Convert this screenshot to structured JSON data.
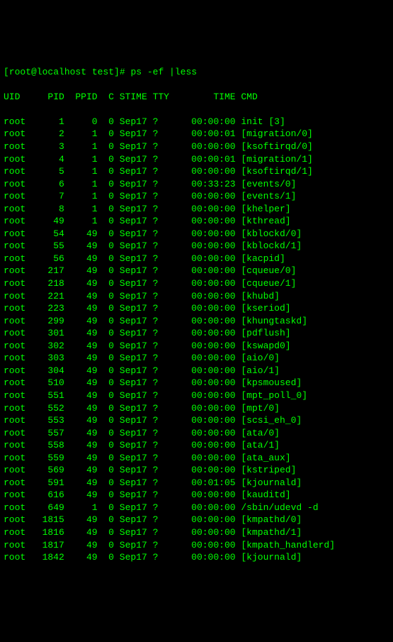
{
  "prompt": {
    "user_host": "[root@localhost test]#",
    "command": "ps -ef |less"
  },
  "headers": {
    "uid": "UID",
    "pid": "PID",
    "ppid": "PPID",
    "c": "C",
    "stime": "STIME",
    "tty": "TTY",
    "time": "TIME",
    "cmd": "CMD"
  },
  "rows": [
    {
      "uid": "root",
      "pid": "1",
      "ppid": "0",
      "c": "0",
      "stime": "Sep17",
      "tty": "?",
      "time": "00:00:00",
      "cmd": "init [3]"
    },
    {
      "uid": "root",
      "pid": "2",
      "ppid": "1",
      "c": "0",
      "stime": "Sep17",
      "tty": "?",
      "time": "00:00:01",
      "cmd": "[migration/0]"
    },
    {
      "uid": "root",
      "pid": "3",
      "ppid": "1",
      "c": "0",
      "stime": "Sep17",
      "tty": "?",
      "time": "00:00:00",
      "cmd": "[ksoftirqd/0]"
    },
    {
      "uid": "root",
      "pid": "4",
      "ppid": "1",
      "c": "0",
      "stime": "Sep17",
      "tty": "?",
      "time": "00:00:01",
      "cmd": "[migration/1]"
    },
    {
      "uid": "root",
      "pid": "5",
      "ppid": "1",
      "c": "0",
      "stime": "Sep17",
      "tty": "?",
      "time": "00:00:00",
      "cmd": "[ksoftirqd/1]"
    },
    {
      "uid": "root",
      "pid": "6",
      "ppid": "1",
      "c": "0",
      "stime": "Sep17",
      "tty": "?",
      "time": "00:33:23",
      "cmd": "[events/0]"
    },
    {
      "uid": "root",
      "pid": "7",
      "ppid": "1",
      "c": "0",
      "stime": "Sep17",
      "tty": "?",
      "time": "00:00:00",
      "cmd": "[events/1]"
    },
    {
      "uid": "root",
      "pid": "8",
      "ppid": "1",
      "c": "0",
      "stime": "Sep17",
      "tty": "?",
      "time": "00:00:00",
      "cmd": "[khelper]"
    },
    {
      "uid": "root",
      "pid": "49",
      "ppid": "1",
      "c": "0",
      "stime": "Sep17",
      "tty": "?",
      "time": "00:00:00",
      "cmd": "[kthread]"
    },
    {
      "uid": "root",
      "pid": "54",
      "ppid": "49",
      "c": "0",
      "stime": "Sep17",
      "tty": "?",
      "time": "00:00:00",
      "cmd": "[kblockd/0]"
    },
    {
      "uid": "root",
      "pid": "55",
      "ppid": "49",
      "c": "0",
      "stime": "Sep17",
      "tty": "?",
      "time": "00:00:00",
      "cmd": "[kblockd/1]"
    },
    {
      "uid": "root",
      "pid": "56",
      "ppid": "49",
      "c": "0",
      "stime": "Sep17",
      "tty": "?",
      "time": "00:00:00",
      "cmd": "[kacpid]"
    },
    {
      "uid": "root",
      "pid": "217",
      "ppid": "49",
      "c": "0",
      "stime": "Sep17",
      "tty": "?",
      "time": "00:00:00",
      "cmd": "[cqueue/0]"
    },
    {
      "uid": "root",
      "pid": "218",
      "ppid": "49",
      "c": "0",
      "stime": "Sep17",
      "tty": "?",
      "time": "00:00:00",
      "cmd": "[cqueue/1]"
    },
    {
      "uid": "root",
      "pid": "221",
      "ppid": "49",
      "c": "0",
      "stime": "Sep17",
      "tty": "?",
      "time": "00:00:00",
      "cmd": "[khubd]"
    },
    {
      "uid": "root",
      "pid": "223",
      "ppid": "49",
      "c": "0",
      "stime": "Sep17",
      "tty": "?",
      "time": "00:00:00",
      "cmd": "[kseriod]"
    },
    {
      "uid": "root",
      "pid": "299",
      "ppid": "49",
      "c": "0",
      "stime": "Sep17",
      "tty": "?",
      "time": "00:00:00",
      "cmd": "[khungtaskd]"
    },
    {
      "uid": "root",
      "pid": "301",
      "ppid": "49",
      "c": "0",
      "stime": "Sep17",
      "tty": "?",
      "time": "00:00:00",
      "cmd": "[pdflush]"
    },
    {
      "uid": "root",
      "pid": "302",
      "ppid": "49",
      "c": "0",
      "stime": "Sep17",
      "tty": "?",
      "time": "00:00:00",
      "cmd": "[kswapd0]"
    },
    {
      "uid": "root",
      "pid": "303",
      "ppid": "49",
      "c": "0",
      "stime": "Sep17",
      "tty": "?",
      "time": "00:00:00",
      "cmd": "[aio/0]"
    },
    {
      "uid": "root",
      "pid": "304",
      "ppid": "49",
      "c": "0",
      "stime": "Sep17",
      "tty": "?",
      "time": "00:00:00",
      "cmd": "[aio/1]"
    },
    {
      "uid": "root",
      "pid": "510",
      "ppid": "49",
      "c": "0",
      "stime": "Sep17",
      "tty": "?",
      "time": "00:00:00",
      "cmd": "[kpsmoused]"
    },
    {
      "uid": "root",
      "pid": "551",
      "ppid": "49",
      "c": "0",
      "stime": "Sep17",
      "tty": "?",
      "time": "00:00:00",
      "cmd": "[mpt_poll_0]"
    },
    {
      "uid": "root",
      "pid": "552",
      "ppid": "49",
      "c": "0",
      "stime": "Sep17",
      "tty": "?",
      "time": "00:00:00",
      "cmd": "[mpt/0]"
    },
    {
      "uid": "root",
      "pid": "553",
      "ppid": "49",
      "c": "0",
      "stime": "Sep17",
      "tty": "?",
      "time": "00:00:00",
      "cmd": "[scsi_eh_0]"
    },
    {
      "uid": "root",
      "pid": "557",
      "ppid": "49",
      "c": "0",
      "stime": "Sep17",
      "tty": "?",
      "time": "00:00:00",
      "cmd": "[ata/0]"
    },
    {
      "uid": "root",
      "pid": "558",
      "ppid": "49",
      "c": "0",
      "stime": "Sep17",
      "tty": "?",
      "time": "00:00:00",
      "cmd": "[ata/1]"
    },
    {
      "uid": "root",
      "pid": "559",
      "ppid": "49",
      "c": "0",
      "stime": "Sep17",
      "tty": "?",
      "time": "00:00:00",
      "cmd": "[ata_aux]"
    },
    {
      "uid": "root",
      "pid": "569",
      "ppid": "49",
      "c": "0",
      "stime": "Sep17",
      "tty": "?",
      "time": "00:00:00",
      "cmd": "[kstriped]"
    },
    {
      "uid": "root",
      "pid": "591",
      "ppid": "49",
      "c": "0",
      "stime": "Sep17",
      "tty": "?",
      "time": "00:01:05",
      "cmd": "[kjournald]"
    },
    {
      "uid": "root",
      "pid": "616",
      "ppid": "49",
      "c": "0",
      "stime": "Sep17",
      "tty": "?",
      "time": "00:00:00",
      "cmd": "[kauditd]"
    },
    {
      "uid": "root",
      "pid": "649",
      "ppid": "1",
      "c": "0",
      "stime": "Sep17",
      "tty": "?",
      "time": "00:00:00",
      "cmd": "/sbin/udevd -d"
    },
    {
      "uid": "root",
      "pid": "1815",
      "ppid": "49",
      "c": "0",
      "stime": "Sep17",
      "tty": "?",
      "time": "00:00:00",
      "cmd": "[kmpathd/0]"
    },
    {
      "uid": "root",
      "pid": "1816",
      "ppid": "49",
      "c": "0",
      "stime": "Sep17",
      "tty": "?",
      "time": "00:00:00",
      "cmd": "[kmpathd/1]"
    },
    {
      "uid": "root",
      "pid": "1817",
      "ppid": "49",
      "c": "0",
      "stime": "Sep17",
      "tty": "?",
      "time": "00:00:00",
      "cmd": "[kmpath_handlerd]"
    },
    {
      "uid": "root",
      "pid": "1842",
      "ppid": "49",
      "c": "0",
      "stime": "Sep17",
      "tty": "?",
      "time": "00:00:00",
      "cmd": "[kjournald]"
    }
  ]
}
